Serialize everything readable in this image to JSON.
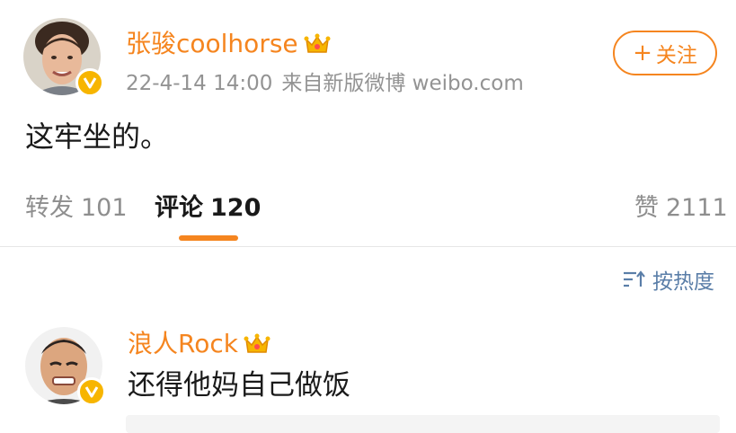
{
  "post": {
    "username": "张骏coolhorse",
    "avatar_icon": "user-avatar",
    "badge_icon": "verified-v-badge",
    "vip_icon": "vip-crown-icon",
    "time": "22-4-14 14:00",
    "source": "来自新版微博 weibo.com",
    "follow_label": "关注",
    "follow_plus": "+",
    "text": "这牢坐的。"
  },
  "tabs": {
    "repost_label": "转发",
    "repost_count": "101",
    "comments_label": "评论",
    "comments_count": "120",
    "likes_label": "赞",
    "likes_count": "2111"
  },
  "sort": {
    "label": "按热度",
    "icon": "sort-icon"
  },
  "comment": {
    "username": "浪人Rock",
    "text": "还得他妈自己做饭",
    "avatar_icon": "user-avatar",
    "badge_icon": "verified-v-badge",
    "vip_icon": "vip-crown-icon"
  },
  "colors": {
    "accent": "#f5851f",
    "link_blue": "#5a7ea8",
    "muted": "#939393",
    "badge": "#f7b500"
  }
}
